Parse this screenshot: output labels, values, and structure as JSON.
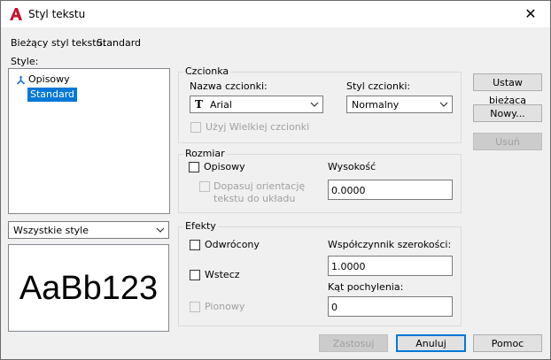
{
  "window": {
    "title": "Styl tekstu",
    "close_glyph": "✕"
  },
  "current_style": {
    "label": "Bieżący styl tekstu:",
    "value": "Standard"
  },
  "styles": {
    "label": "Style:",
    "items": [
      {
        "label": "Opisowy",
        "icon": "annotative-icon"
      },
      {
        "label": "Standard",
        "selected": true
      }
    ],
    "filter": {
      "value": "Wszystkie style"
    }
  },
  "preview": {
    "text": "AaBb123"
  },
  "font_group": {
    "label": "Czcionka",
    "font_name_label": "Nazwa czcionki:",
    "font_name_value": "Arial",
    "font_style_label": "Styl czcionki:",
    "font_style_value": "Normalny",
    "use_big_font": "Użyj Wielkiej czcionki"
  },
  "size_group": {
    "label": "Rozmiar",
    "annotative": "Opisowy",
    "match_orientation_line1": "Dopasuj orientację",
    "match_orientation_line2": "tekstu do układu",
    "height_label": "Wysokość",
    "height_value": "0.0000"
  },
  "effects_group": {
    "label": "Efekty",
    "upside_down": "Odwrócony",
    "backwards": "Wstecz",
    "vertical": "Pionowy",
    "width_factor_label": "Współczynnik szerokości:",
    "width_factor_value": "1.0000",
    "oblique_label": "Kąt pochylenia:",
    "oblique_value": "0"
  },
  "buttons": {
    "set_current": "Ustaw bieżącą",
    "new": "Nowy...",
    "delete": "Usuń",
    "apply": "Zastosuj",
    "cancel": "Anuluj",
    "help": "Pomoc"
  },
  "colors": {
    "accent": "#0078d7",
    "app_icon": "#c8102e"
  }
}
